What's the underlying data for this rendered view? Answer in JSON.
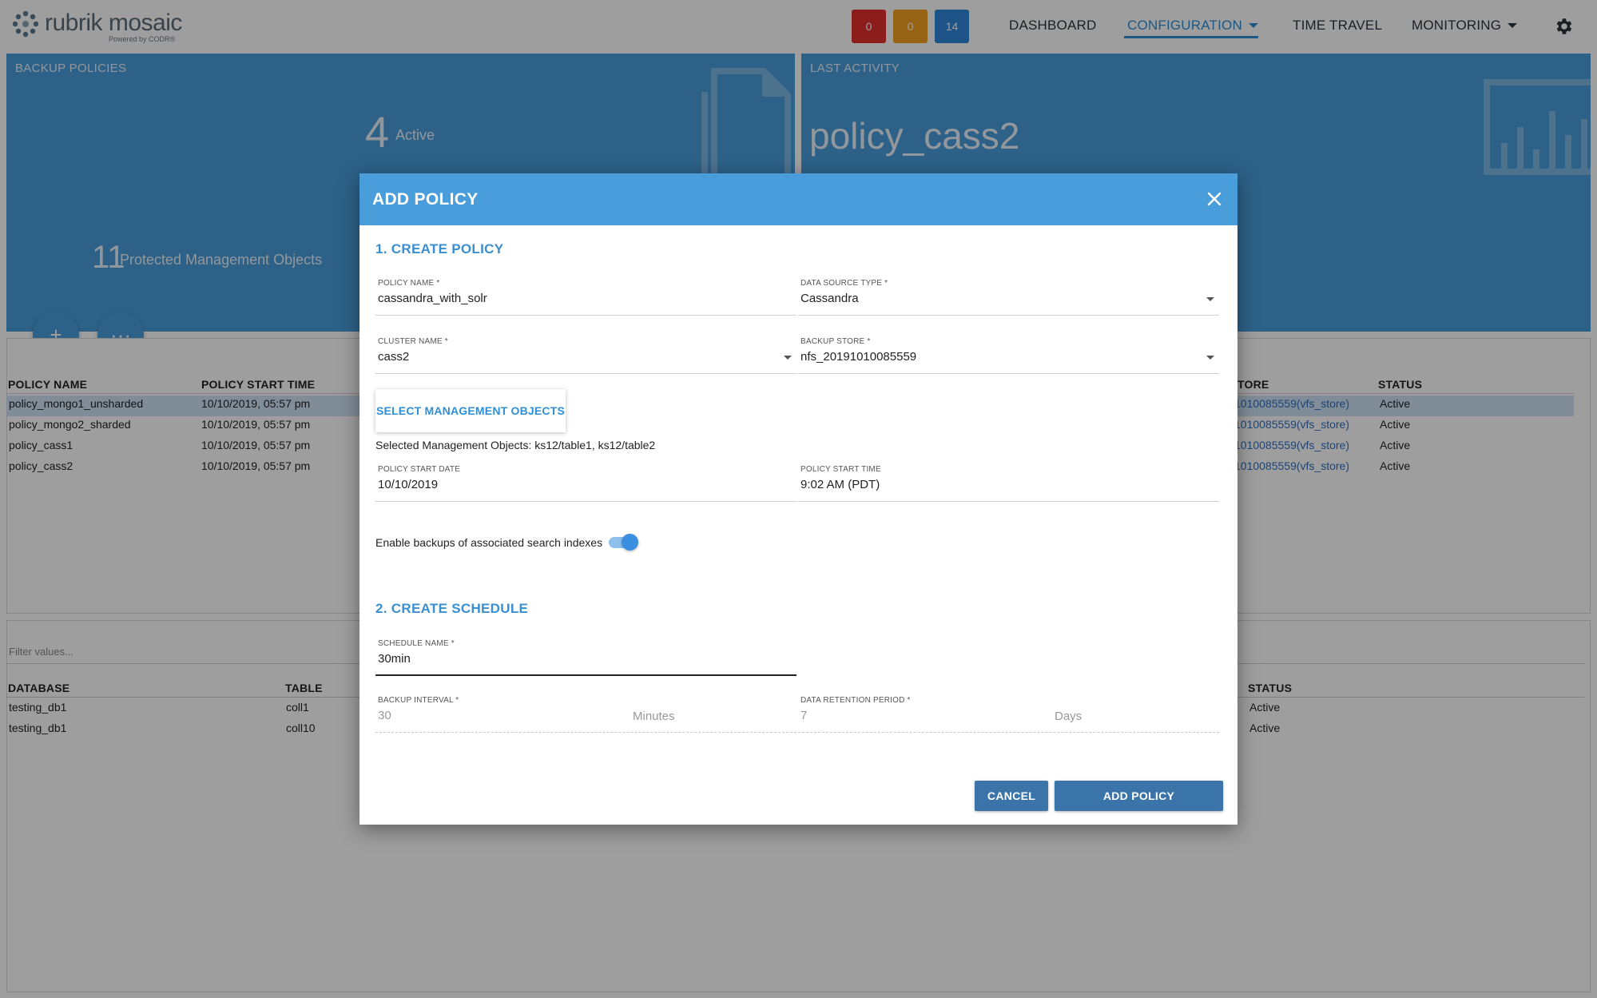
{
  "header": {
    "logo_text": "rubrik mosaic",
    "logo_sub": "Powered by CODR®",
    "alerts": {
      "critical": "0",
      "warning": "0",
      "info": "14"
    },
    "nav": {
      "dashboard": "DASHBOARD",
      "configuration": "CONFIGURATION",
      "time_travel": "TIME TRAVEL",
      "monitoring": "MONITORING"
    }
  },
  "tiles": {
    "backup_policies": {
      "label": "BACKUP POLICIES",
      "active_count": "4",
      "active_label": "Active",
      "protected_count": "11",
      "protected_label": "Protected Management Objects"
    },
    "last_activity": {
      "label": "LAST ACTIVITY",
      "value": "policy_cass2"
    }
  },
  "fabs": {
    "add": "+",
    "more": "···"
  },
  "policies_table": {
    "headers": {
      "name": "POLICY NAME",
      "start_time": "POLICY START TIME",
      "store": "TORE",
      "status": "STATUS"
    },
    "rows": [
      {
        "name": "policy_mongo1_unsharded",
        "start_time": "10/10/2019, 05:57 pm",
        "store": "1010085559(vfs_store)",
        "status": "Active"
      },
      {
        "name": "policy_mongo2_sharded",
        "start_time": "10/10/2019, 05:57 pm",
        "store": "1010085559(vfs_store)",
        "status": "Active"
      },
      {
        "name": "policy_cass1",
        "start_time": "10/10/2019, 05:57 pm",
        "store": "1010085559(vfs_store)",
        "status": "Active"
      },
      {
        "name": "policy_cass2",
        "start_time": "10/10/2019, 05:57 pm",
        "store": "1010085559(vfs_store)",
        "status": "Active"
      }
    ]
  },
  "objects_table": {
    "filter_placeholder": "Filter values...",
    "headers": {
      "database": "DATABASE",
      "table": "TABLE",
      "status": "STATUS"
    },
    "rows": [
      {
        "database": "testing_db1",
        "table": "coll1",
        "status": "Active"
      },
      {
        "database": "testing_db1",
        "table": "coll10",
        "status": "Active"
      }
    ]
  },
  "modal": {
    "title": "ADD POLICY",
    "section1": "1. CREATE POLICY",
    "policy_name": {
      "label": "POLICY NAME *",
      "value": "cassandra_with_solr"
    },
    "data_source_type": {
      "label": "DATA SOURCE TYPE *",
      "value": "Cassandra"
    },
    "cluster_name": {
      "label": "CLUSTER NAME *",
      "value": "cass2"
    },
    "backup_store": {
      "label": "BACKUP STORE *",
      "value": "nfs_20191010085559"
    },
    "select_objects_button": "SELECT MANAGEMENT OBJECTS",
    "selected_objects": "Selected Management Objects: ks12/table1, ks12/table2",
    "start_date": {
      "label": "POLICY START DATE",
      "value": "10/10/2019"
    },
    "start_time": {
      "label": "POLICY START TIME",
      "value": "9:02 AM (PDT)"
    },
    "search_index_toggle": {
      "label": "Enable backups of associated search indexes",
      "enabled": true
    },
    "section2": "2. CREATE SCHEDULE",
    "schedule_name": {
      "label": "SCHEDULE NAME *",
      "value": "30min"
    },
    "backup_interval": {
      "label": "BACKUP INTERVAL *",
      "value": "30",
      "unit": "Minutes"
    },
    "retention_period": {
      "label": "DATA RETENTION PERIOD *",
      "value": "7",
      "unit": "Days"
    },
    "cancel_button": "CANCEL",
    "add_button": "ADD POLICY"
  },
  "colors": {
    "primary": "#4a9ddb",
    "accent": "#2f8fd6",
    "button": "#3b74a8",
    "alert_red": "#e0312b",
    "alert_orange": "#f0a020",
    "alert_blue": "#2f86d8"
  }
}
